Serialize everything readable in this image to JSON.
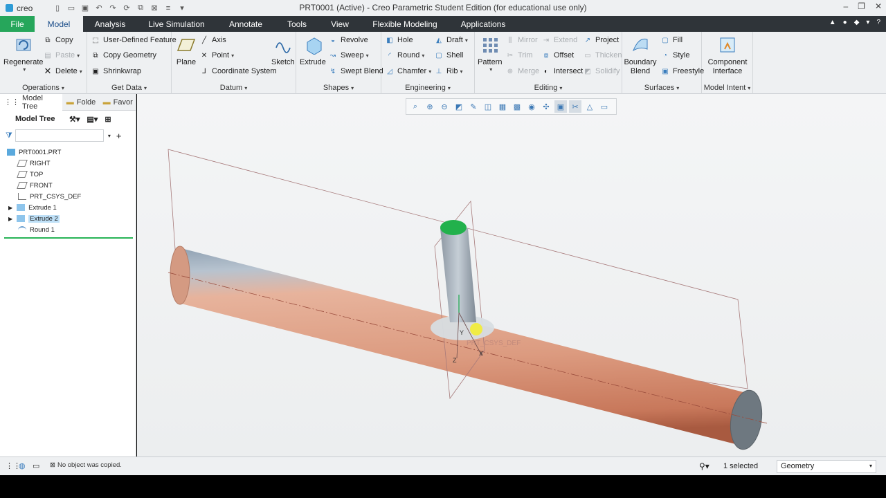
{
  "window": {
    "logo": "creo",
    "title": "PRT0001 (Active) - Creo Parametric Student Edition (for educational use only)"
  },
  "tabs": {
    "file": "File",
    "model": "Model",
    "analysis": "Analysis",
    "live_simulation": "Live Simulation",
    "annotate": "Annotate",
    "tools": "Tools",
    "view": "View",
    "flexible_modeling": "Flexible Modeling",
    "applications": "Applications"
  },
  "ribbon": {
    "operations": {
      "label": "Operations",
      "regenerate": "Regenerate",
      "copy": "Copy",
      "paste": "Paste",
      "delete": "Delete"
    },
    "get_data": {
      "label": "Get Data",
      "udf": "User-Defined Feature",
      "copy_geometry": "Copy Geometry",
      "shrinkwrap": "Shrinkwrap"
    },
    "datum": {
      "label": "Datum",
      "plane": "Plane",
      "axis": "Axis",
      "point": "Point",
      "csys": "Coordinate System",
      "sketch": "Sketch"
    },
    "shapes": {
      "label": "Shapes",
      "extrude": "Extrude",
      "revolve": "Revolve",
      "sweep": "Sweep",
      "swept_blend": "Swept Blend"
    },
    "engineering": {
      "label": "Engineering",
      "hole": "Hole",
      "round": "Round",
      "chamfer": "Chamfer",
      "draft": "Draft",
      "shell": "Shell",
      "rib": "Rib"
    },
    "editing": {
      "label": "Editing",
      "pattern": "Pattern",
      "mirror": "Mirror",
      "trim": "Trim",
      "merge": "Merge",
      "extend": "Extend",
      "offset": "Offset",
      "intersect": "Intersect",
      "project": "Project",
      "thicken": "Thicken",
      "solidify": "Solidify"
    },
    "surfaces": {
      "label": "Surfaces",
      "boundary_blend": "Boundary Blend",
      "fill": "Fill",
      "style": "Style",
      "freestyle": "Freestyle"
    },
    "model_intent": {
      "label": "Model Intent",
      "component_interface": "Component Interface"
    }
  },
  "left_panel": {
    "tabs": {
      "model_tree": "Model Tree",
      "folder": "Folde",
      "favorites": "Favor"
    },
    "header": "Model Tree",
    "tree": {
      "root": "PRT0001.PRT",
      "right": "RIGHT",
      "top": "TOP",
      "front": "FRONT",
      "csys": "PRT_CSYS_DEF",
      "extrude1": "Extrude 1",
      "extrude2": "Extrude 2",
      "round1": "Round 1"
    }
  },
  "viewport": {
    "csys_label": "PRT_CSYS_DEF",
    "axis_x": "X",
    "axis_y": "Y",
    "axis_z": "Z"
  },
  "status": {
    "message": "No object was copied.",
    "selected": "1 selected",
    "filter": "Geometry"
  },
  "colors": {
    "file_tab": "#26a65b",
    "pipe": "#d9957a",
    "selected_face": "#22b14c",
    "tab_bar": "#2f3439"
  }
}
